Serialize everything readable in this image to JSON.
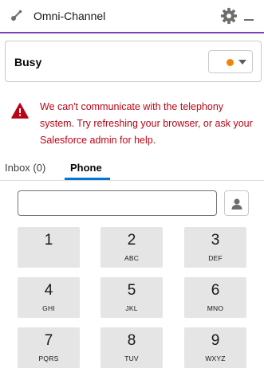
{
  "header": {
    "title": "Omni-Channel",
    "icons": [
      "omni-channel-icon",
      "gear-icon",
      "minimize-icon"
    ]
  },
  "status": {
    "label": "Busy",
    "indicator_color": "#f38303"
  },
  "error": {
    "message": "We can't communicate with the telephony system. Try refreshing your browser, or ask your Salesforce admin for help.",
    "color": "#ba0517"
  },
  "tabs": [
    {
      "label": "Inbox (0)"
    },
    {
      "label": "Phone",
      "active": true
    }
  ],
  "dialer": {
    "input_value": "",
    "keys": [
      {
        "digit": "1",
        "letters": ""
      },
      {
        "digit": "2",
        "letters": "ABC"
      },
      {
        "digit": "3",
        "letters": "DEF"
      },
      {
        "digit": "4",
        "letters": "GHI"
      },
      {
        "digit": "5",
        "letters": "JKL"
      },
      {
        "digit": "6",
        "letters": "MNO"
      },
      {
        "digit": "7",
        "letters": "PQRS"
      },
      {
        "digit": "8",
        "letters": "TUV"
      },
      {
        "digit": "9",
        "letters": "WXYZ"
      }
    ]
  },
  "colors": {
    "accent": "#7e3fb0",
    "tab_active": "#0176d3",
    "key_bg": "#e5e5e5"
  }
}
